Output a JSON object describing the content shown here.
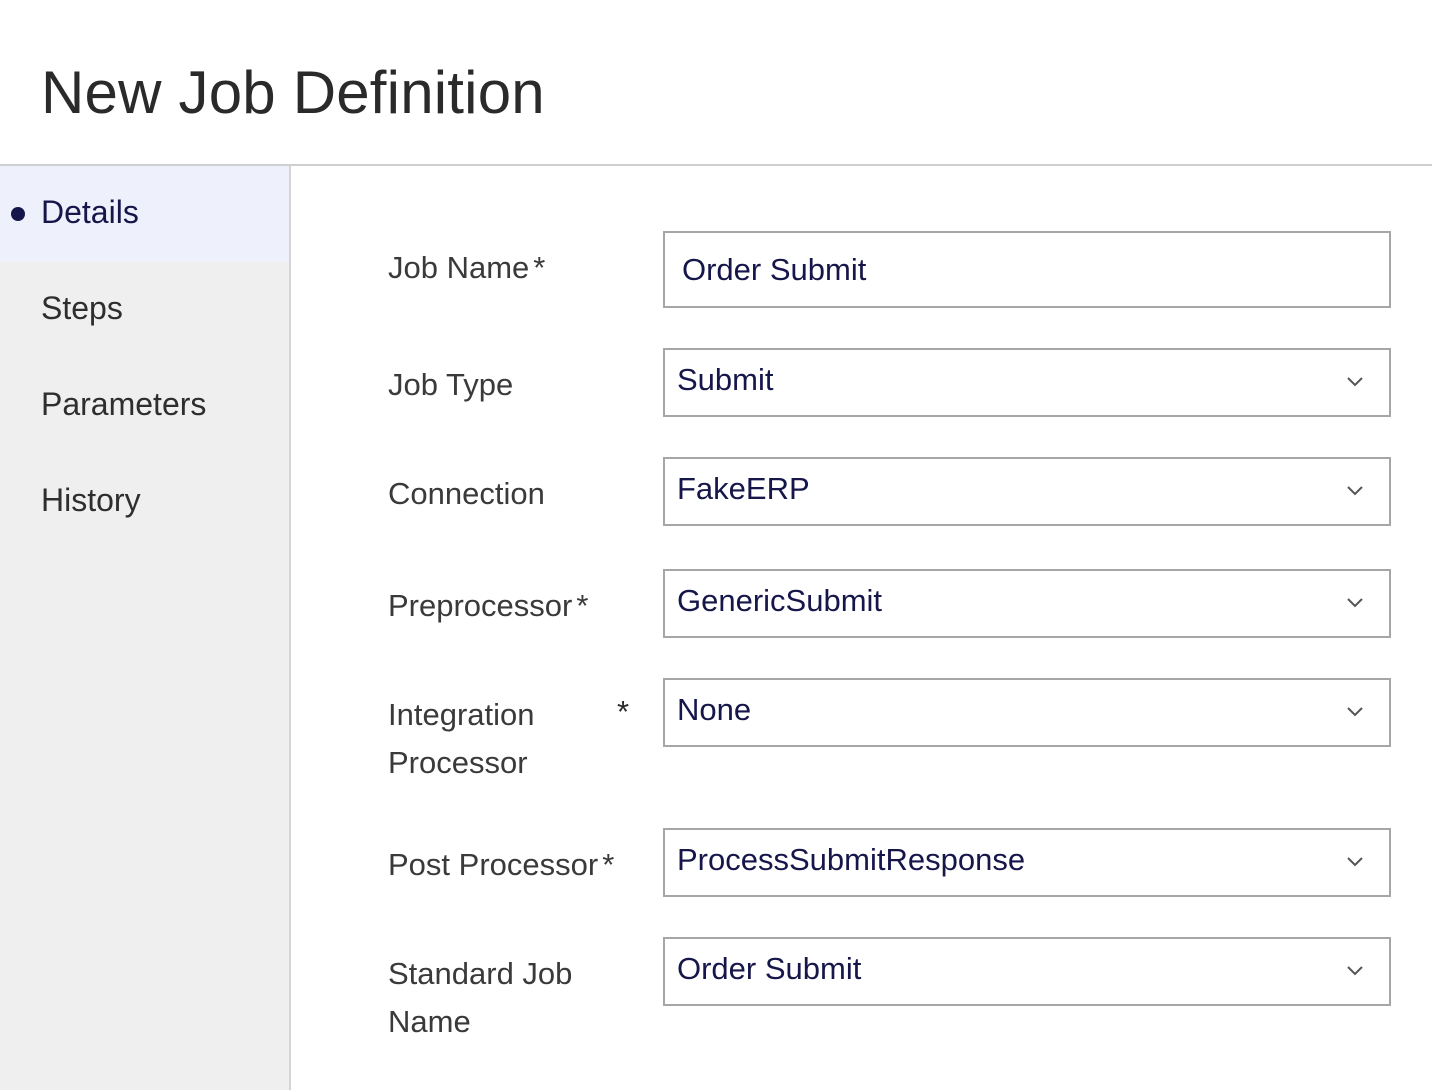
{
  "header": {
    "title": "New Job Definition"
  },
  "sidebar": {
    "items": [
      {
        "label": "Details",
        "active": true
      },
      {
        "label": "Steps",
        "active": false
      },
      {
        "label": "Parameters",
        "active": false
      },
      {
        "label": "History",
        "active": false
      }
    ]
  },
  "form": {
    "required_marker": "*",
    "job_name": {
      "label": "Job Name",
      "value": "Order Submit",
      "required": true
    },
    "job_type": {
      "label": "Job Type",
      "value": "Submit",
      "required": false
    },
    "connection": {
      "label": "Connection",
      "value": "FakeERP",
      "required": false
    },
    "preprocessor": {
      "label": "Preprocessor",
      "value": "GenericSubmit",
      "required": true
    },
    "integration_processor": {
      "label_line1": "Integration",
      "label_line2": "Processor",
      "value": "None",
      "required": true
    },
    "post_processor": {
      "label": "Post Processor",
      "value": "ProcessSubmitResponse",
      "required": true
    },
    "standard_job_name": {
      "label_line1": "Standard Job",
      "label_line2": "Name",
      "value": "Order Submit",
      "required": false
    }
  },
  "icons": {
    "chevron": "chevron-down-icon",
    "active_marker": "bullet-dot-icon"
  },
  "colors": {
    "accent": "#16164a",
    "sidebar_bg": "#efefef",
    "active_item_bg": "#eef0fc",
    "input_border": "#a6a6a6"
  }
}
